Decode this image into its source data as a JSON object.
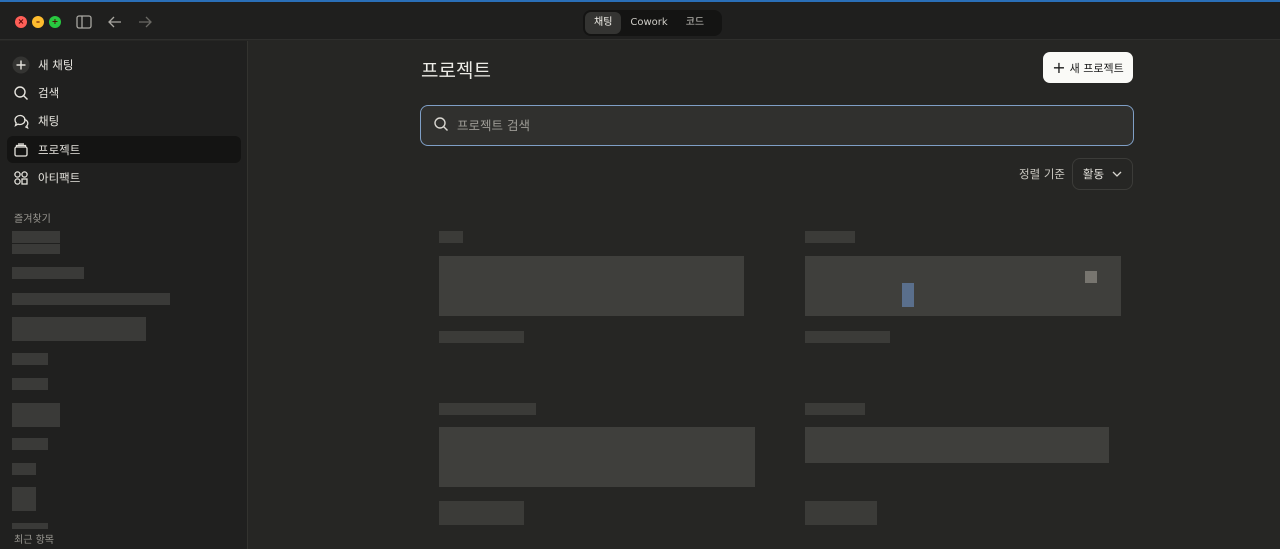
{
  "titlebar": {
    "modes": [
      {
        "label": "채팅",
        "active": true
      },
      {
        "label": "Cowork",
        "active": false
      },
      {
        "label": "코드",
        "active": false
      }
    ],
    "icons": [
      "sidebar-toggle-icon",
      "back-arrow-icon",
      "forward-arrow-icon"
    ]
  },
  "sidebar": {
    "items": [
      {
        "label": "새 채팅",
        "icon": "plus-icon"
      },
      {
        "label": "검색",
        "icon": "search-icon"
      },
      {
        "label": "채팅",
        "icon": "chat-bubbles-icon"
      },
      {
        "label": "프로젝트",
        "icon": "folder-icon",
        "active": true
      },
      {
        "label": "아티팩트",
        "icon": "artifacts-icon"
      }
    ],
    "favorites_label": "즐겨찾기",
    "recents_label": "최근 항목"
  },
  "main": {
    "title": "프로젝트",
    "new_project_label": "새 프로젝트",
    "search_placeholder": "프로젝트 검색",
    "sort_label": "정렬 기준",
    "sort_value": "활동"
  },
  "colors": {
    "accent_border": "#7f9fc6",
    "background": "#262624",
    "sidebar": "#20201f",
    "button": "#fafaf7"
  }
}
